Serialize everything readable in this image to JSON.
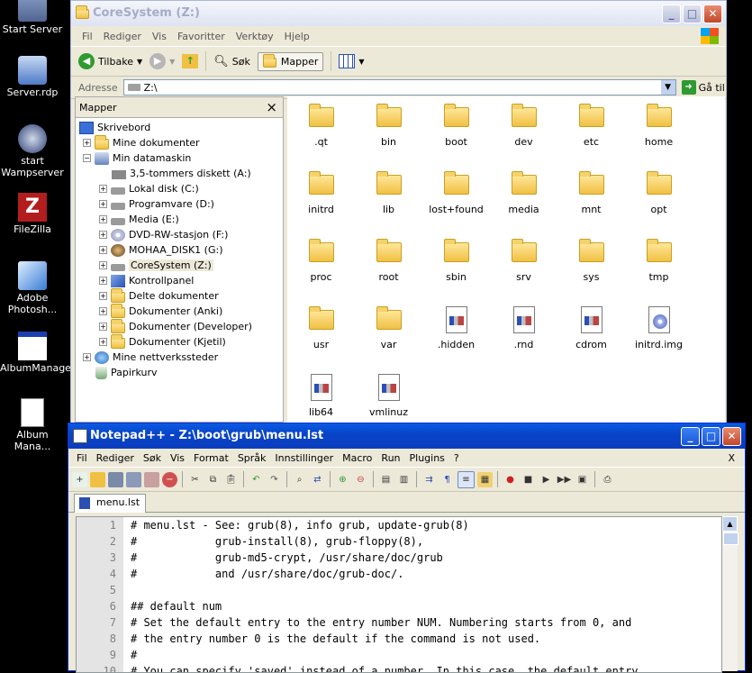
{
  "desktop": {
    "icons": [
      {
        "label": "Start Server"
      },
      {
        "label": "Server.rdp"
      },
      {
        "label": "start Wampserver"
      },
      {
        "label": "FileZilla"
      },
      {
        "label": "Adobe Photosh..."
      },
      {
        "label": "AlbumManager"
      },
      {
        "label": "Album Mana..."
      }
    ]
  },
  "explorer": {
    "title": "CoreSystem (Z:)",
    "menu": [
      "Fil",
      "Rediger",
      "Vis",
      "Favoritter",
      "Verktøy",
      "Hjelp"
    ],
    "toolbar": {
      "back": "Tilbake",
      "search": "Søk",
      "folders": "Mapper"
    },
    "address": {
      "label": "Adresse",
      "value": "Z:\\",
      "go": "Gå til"
    },
    "folders_pane": {
      "title": "Mapper",
      "close": "×",
      "tree": [
        {
          "label": "Skrivebord"
        },
        {
          "label": "Mine dokumenter"
        },
        {
          "label": "Min datamaskin"
        },
        {
          "label": "3,5-tommers diskett (A:)"
        },
        {
          "label": "Lokal disk (C:)"
        },
        {
          "label": "Programvare (D:)"
        },
        {
          "label": "Media (E:)"
        },
        {
          "label": "DVD-RW-stasjon (F:)"
        },
        {
          "label": "MOHAA_DISK1 (G:)"
        },
        {
          "label": "CoreSystem (Z:)"
        },
        {
          "label": "Kontrollpanel"
        },
        {
          "label": "Delte dokumenter"
        },
        {
          "label": "Dokumenter (Anki)"
        },
        {
          "label": "Dokumenter (Developer)"
        },
        {
          "label": "Dokumenter (Kjetil)"
        },
        {
          "label": "Mine nettverkssteder"
        },
        {
          "label": "Papirkurv"
        }
      ]
    },
    "files": [
      {
        "name": ".qt",
        "type": "folder"
      },
      {
        "name": "bin",
        "type": "folder"
      },
      {
        "name": "boot",
        "type": "folder"
      },
      {
        "name": "dev",
        "type": "folder"
      },
      {
        "name": "etc",
        "type": "folder"
      },
      {
        "name": "home",
        "type": "folder"
      },
      {
        "name": "initrd",
        "type": "folder"
      },
      {
        "name": "lib",
        "type": "folder"
      },
      {
        "name": "lost+found",
        "type": "folder"
      },
      {
        "name": "media",
        "type": "folder"
      },
      {
        "name": "mnt",
        "type": "folder"
      },
      {
        "name": "opt",
        "type": "folder"
      },
      {
        "name": "proc",
        "type": "folder"
      },
      {
        "name": "root",
        "type": "folder"
      },
      {
        "name": "sbin",
        "type": "folder"
      },
      {
        "name": "srv",
        "type": "folder"
      },
      {
        "name": "sys",
        "type": "folder"
      },
      {
        "name": "tmp",
        "type": "folder"
      },
      {
        "name": "usr",
        "type": "folder"
      },
      {
        "name": "var",
        "type": "folder"
      },
      {
        "name": ".hidden",
        "type": "file"
      },
      {
        "name": ".rnd",
        "type": "file"
      },
      {
        "name": "cdrom",
        "type": "file"
      },
      {
        "name": "initrd.img",
        "type": "disc"
      },
      {
        "name": "lib64",
        "type": "file"
      },
      {
        "name": "vmlinuz",
        "type": "file"
      }
    ]
  },
  "notepad": {
    "title": "Notepad++ - Z:\\boot\\grub\\menu.lst",
    "menu": [
      "Fil",
      "Rediger",
      "Søk",
      "Vis",
      "Format",
      "Språk",
      "Innstillinger",
      "Macro",
      "Run",
      "Plugins",
      "?"
    ],
    "menu_close": "X",
    "tab": "menu.lst",
    "lines": [
      {
        "n": "1",
        "t": "# menu.lst - See: grub(8), info grub, update-grub(8)"
      },
      {
        "n": "2",
        "t": "#            grub-install(8), grub-floppy(8),"
      },
      {
        "n": "3",
        "t": "#            grub-md5-crypt, /usr/share/doc/grub"
      },
      {
        "n": "4",
        "t": "#            and /usr/share/doc/grub-doc/."
      },
      {
        "n": "5",
        "t": ""
      },
      {
        "n": "6",
        "t": "## default num"
      },
      {
        "n": "7",
        "t": "# Set the default entry to the entry number NUM. Numbering starts from 0, and"
      },
      {
        "n": "8",
        "t": "# the entry number 0 is the default if the command is not used."
      },
      {
        "n": "9",
        "t": "#"
      },
      {
        "n": "10",
        "t": "# You can specify 'saved' instead of a number. In this case, the default entry"
      }
    ]
  }
}
